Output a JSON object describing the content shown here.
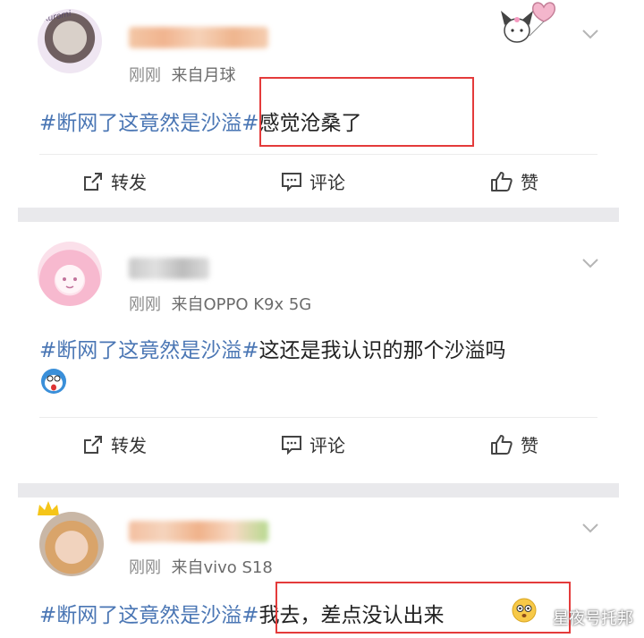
{
  "posts": [
    {
      "time": "刚刚",
      "source": "来自月球",
      "topic": "#断网了这竟然是沙溢#",
      "text": "感觉沧桑了",
      "avatar_badge": "Kuromi"
    },
    {
      "time": "刚刚",
      "source": "来自OPPO K9x 5G",
      "topic": "#断网了这竟然是沙溢#",
      "text": "这还是我认识的那个沙溢吗"
    },
    {
      "time": "刚刚",
      "source": "来自vivo S18",
      "topic": "#断网了这竟然是沙溢#",
      "text": "我去，差点没认出来"
    }
  ],
  "actions": {
    "repost": "转发",
    "comment": "评论",
    "like": "赞"
  },
  "watermark": "星夜号托邦",
  "colors": {
    "topic": "#4a76b4",
    "highlight_box": "#e43b3b",
    "separator": "#e9e9ec"
  }
}
